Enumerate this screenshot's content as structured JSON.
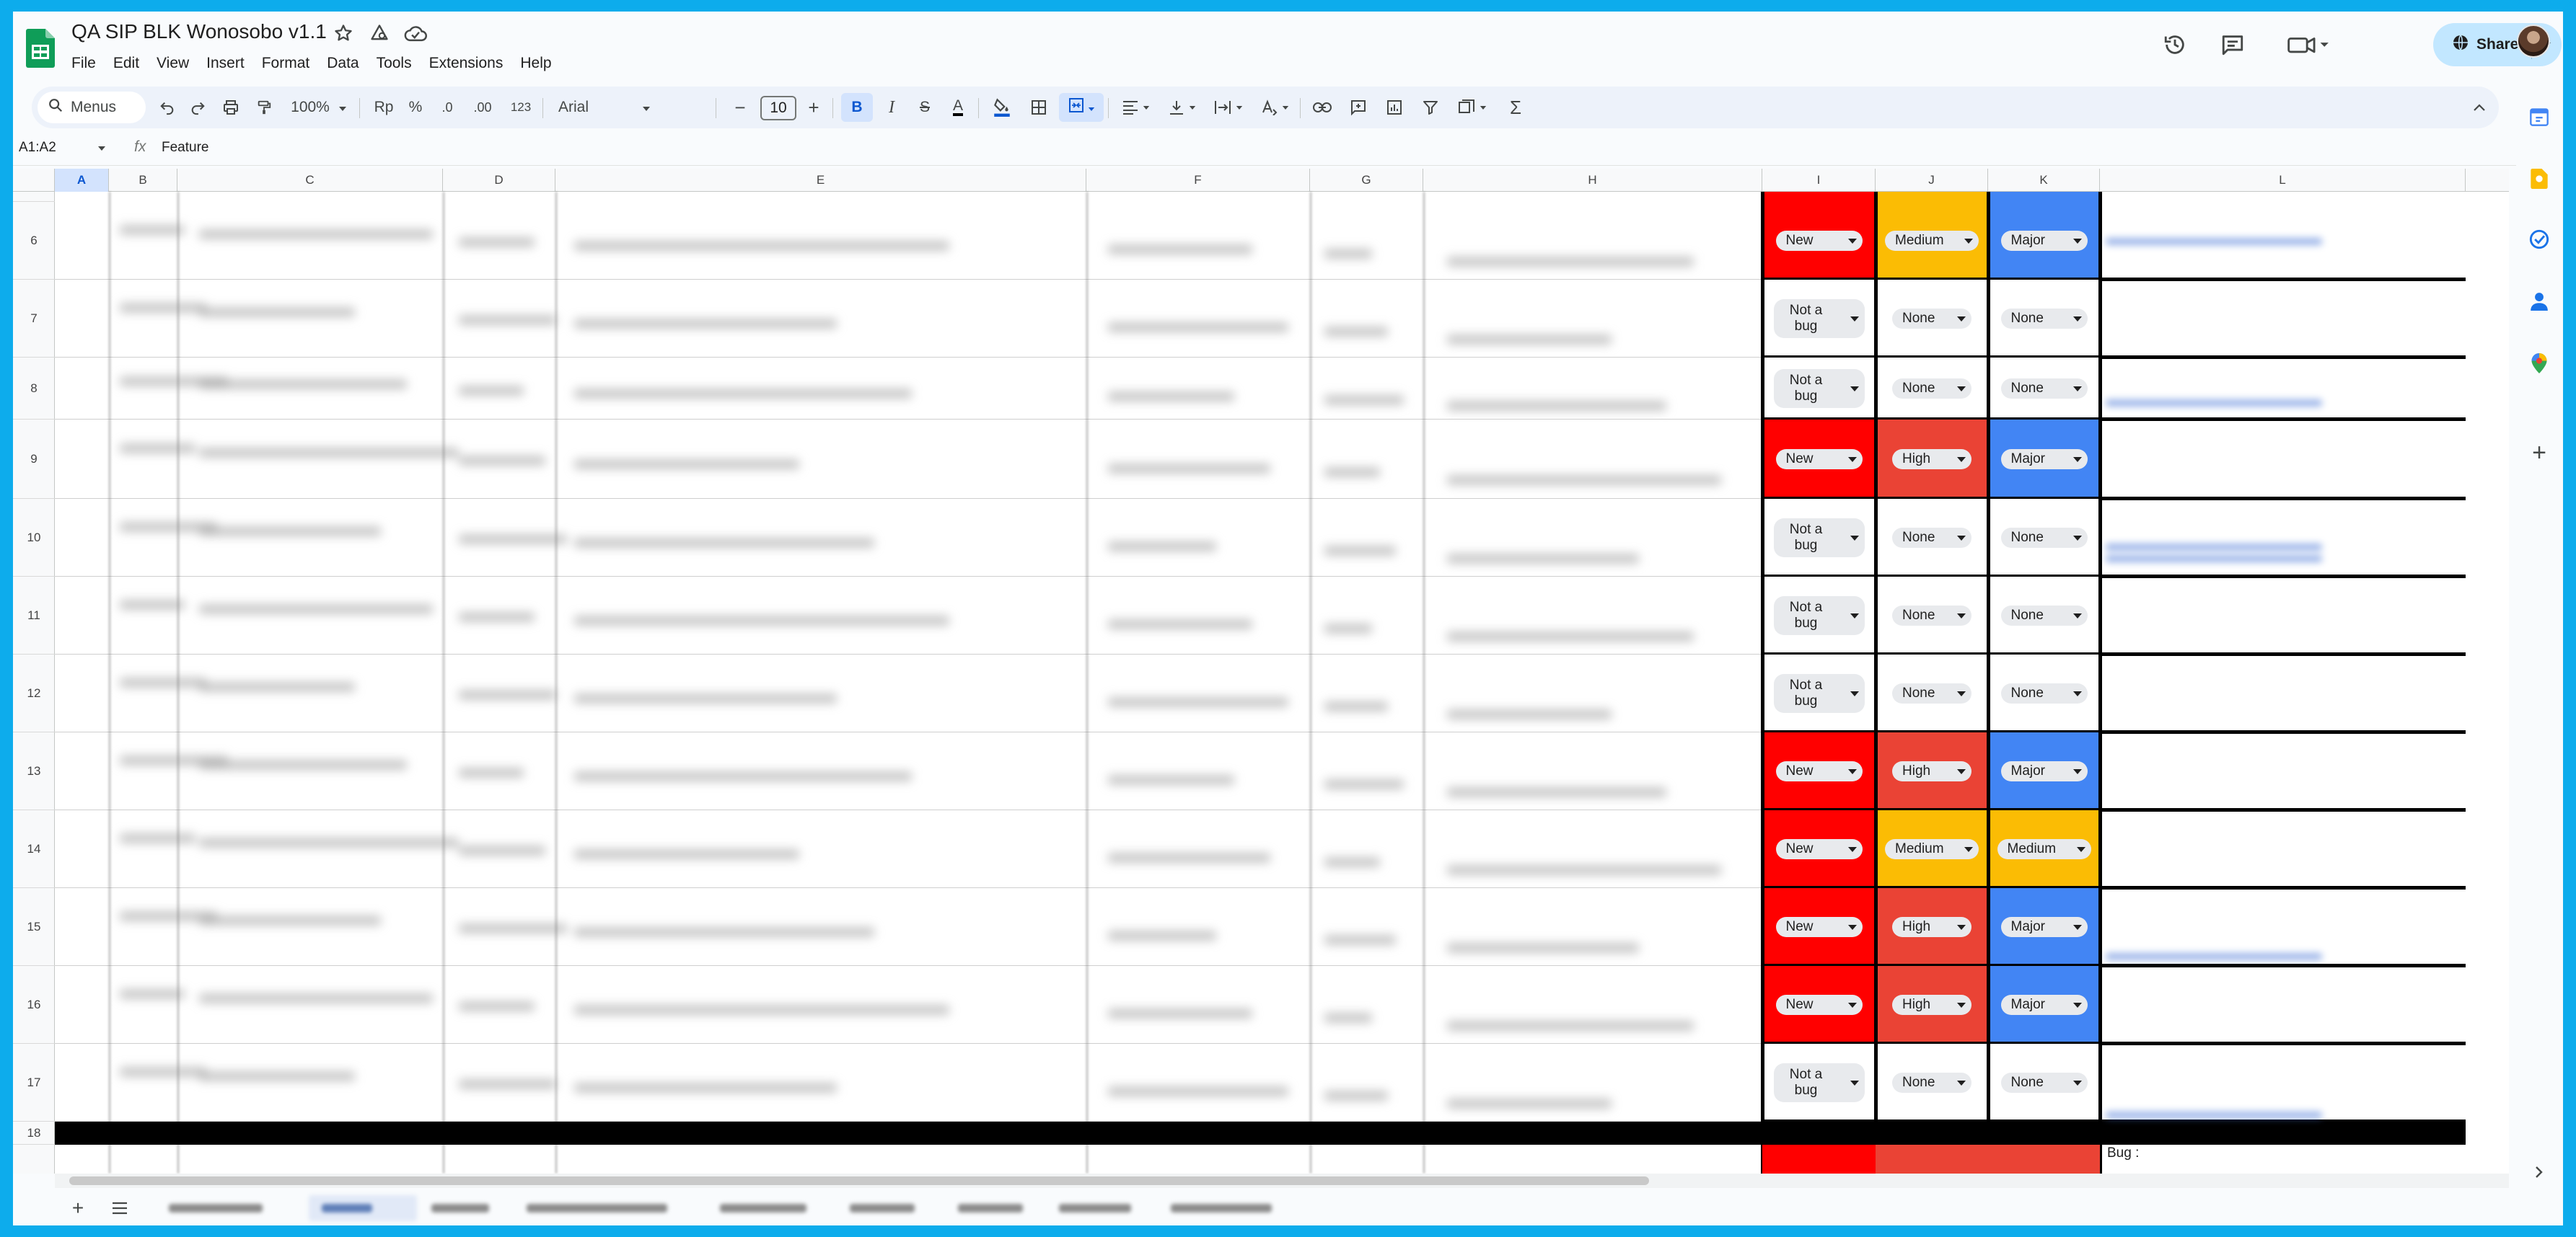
{
  "header": {
    "doc_title": "QA SIP BLK Wonosobo v1.1",
    "menu": [
      "File",
      "Edit",
      "View",
      "Insert",
      "Format",
      "Data",
      "Tools",
      "Extensions",
      "Help"
    ],
    "share_label": "Share"
  },
  "toolbar": {
    "search_label": "Menus",
    "zoom": "100%",
    "currency": "Rp",
    "percent": "%",
    "dec_decrease": ".0",
    "dec_increase": ".00",
    "number_format": "123",
    "font": "Arial",
    "font_size": "10",
    "bold": "B",
    "italic": "I",
    "strike": "S",
    "text_color": "A",
    "minus": "−",
    "plus": "+",
    "sum": "Σ"
  },
  "formula_bar": {
    "name_box": "A1:A2",
    "fx": "fx",
    "value": "Feature"
  },
  "columns": [
    "A",
    "B",
    "C",
    "D",
    "E",
    "F",
    "G",
    "H",
    "I",
    "J",
    "K",
    "L"
  ],
  "rows": [
    {
      "num": "6",
      "status": "New",
      "priority": "Medium",
      "severity": "Major"
    },
    {
      "num": "7",
      "status": "Not a bug",
      "priority": "None",
      "severity": "None"
    },
    {
      "num": "8",
      "status": "Not a bug",
      "priority": "None",
      "severity": "None"
    },
    {
      "num": "9",
      "status": "New",
      "priority": "High",
      "severity": "Major"
    },
    {
      "num": "10",
      "status": "Not a bug",
      "priority": "None",
      "severity": "None"
    },
    {
      "num": "11",
      "status": "Not a bug",
      "priority": "None",
      "severity": "None"
    },
    {
      "num": "12",
      "status": "Not a bug",
      "priority": "None",
      "severity": "None"
    },
    {
      "num": "13",
      "status": "New",
      "priority": "High",
      "severity": "Major"
    },
    {
      "num": "14",
      "status": "New",
      "priority": "Medium",
      "severity": "Medium"
    },
    {
      "num": "15",
      "status": "New",
      "priority": "High",
      "severity": "Major"
    },
    {
      "num": "16",
      "status": "New",
      "priority": "High",
      "severity": "Major"
    },
    {
      "num": "17",
      "status": "Not a bug",
      "priority": "None",
      "severity": "None"
    }
  ],
  "row_18": {
    "num": "18",
    "l_text": "Bug :"
  },
  "colors": {
    "status_new": "#ff0000",
    "priority_high": "#ea4335",
    "priority_medium": "#fbbc04",
    "severity_major": "#4285f4",
    "severity_medium": "#fbbc04",
    "none": "#ffffff",
    "accent": "#0b57d0",
    "share_bg": "#c2e7ff",
    "frame": "#0dacec"
  }
}
